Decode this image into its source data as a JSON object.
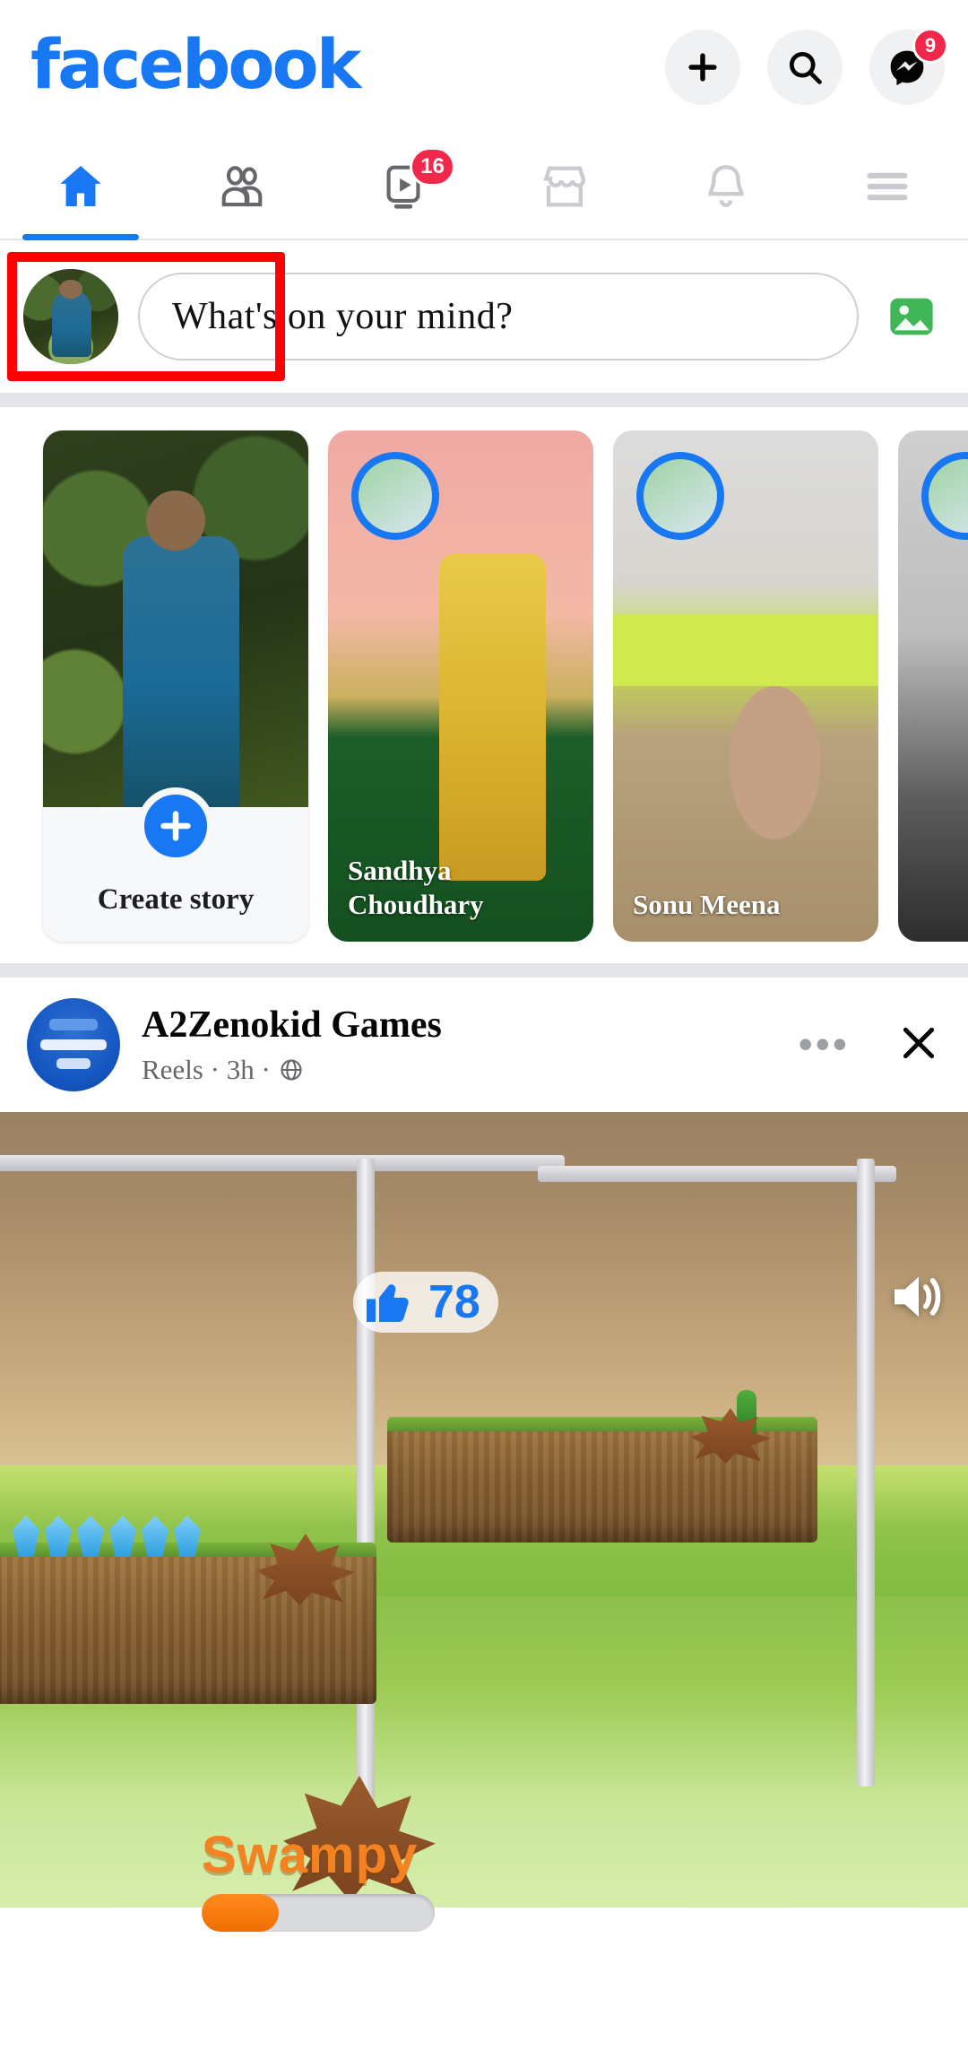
{
  "app": {
    "brand": "facebook",
    "brand_color": "#1877F2"
  },
  "topbar": {
    "icons": [
      {
        "name": "plus-icon",
        "label": "Create"
      },
      {
        "name": "search-icon",
        "label": "Search"
      },
      {
        "name": "messenger-icon",
        "label": "Messenger"
      }
    ],
    "messenger_badge": "9"
  },
  "tabs": [
    {
      "name": "home",
      "label": "Home",
      "active": true,
      "badge": ""
    },
    {
      "name": "friends",
      "label": "Friends",
      "active": false,
      "badge": ""
    },
    {
      "name": "video",
      "label": "Video",
      "active": false,
      "badge": "16"
    },
    {
      "name": "marketplace",
      "label": "Marketplace",
      "active": false,
      "badge": ""
    },
    {
      "name": "notifications",
      "label": "Notifications",
      "active": false,
      "badge": ""
    },
    {
      "name": "menu",
      "label": "Menu",
      "active": false,
      "badge": ""
    }
  ],
  "composer": {
    "placeholder": "What's on your mind?",
    "value": "",
    "photo_icon": "photo-gallery-icon",
    "avatar_alt": "profile-photo",
    "highlight_color": "#FF0000"
  },
  "stories": {
    "create": {
      "plus_icon": "plus-icon",
      "label": "Create story"
    },
    "items": [
      {
        "name": "Sandhya Choudhary"
      },
      {
        "name": "Sonu Meena"
      },
      {
        "name": ""
      }
    ]
  },
  "post": {
    "author": "A2Zenokid Games",
    "meta": "Reels · 3h ·",
    "privacy_icon": "globe-icon",
    "menu_icon": "more-options-icon",
    "close_icon": "close-icon",
    "media": {
      "type": "game-video",
      "like_icon": "thumbs-up-icon",
      "like_count": "78",
      "sound_icon": "speaker-icon",
      "character_name": "Swampy",
      "progress_percent": 33
    }
  }
}
